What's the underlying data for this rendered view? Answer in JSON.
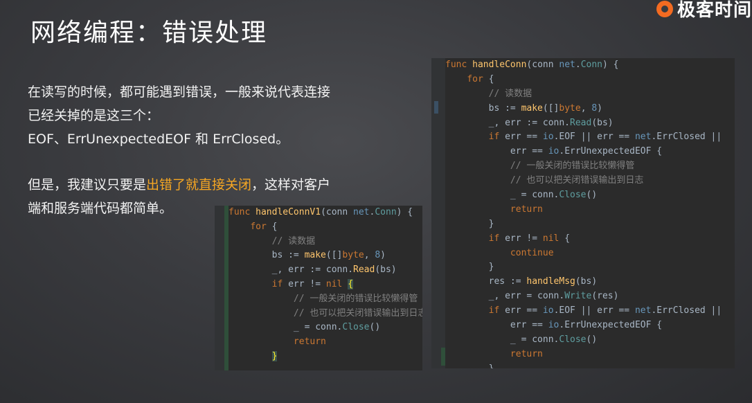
{
  "brand": {
    "logo_text": "极客时间"
  },
  "slide": {
    "title": "网络编程：错误处理",
    "p1_line1": "在读写的时候，都可能遇到错误，一般来说代表连接",
    "p1_line2": "已经关掉的是这三个：",
    "p1_line3": "EOF、ErrUnexpectedEOF 和 ErrClosed。",
    "p2_prefix": "但是，我建议只要是",
    "p2_highlight": "出错了就直接关闭",
    "p2_suffix": "，这样对客户",
    "p2_line2": "端和服务端代码都简单。"
  },
  "code_small": {
    "lines": [
      [
        [
          "kw",
          "func "
        ],
        [
          "call",
          "handleConnV1"
        ],
        [
          "plain",
          "(conn "
        ],
        [
          "pkg",
          "net"
        ],
        [
          "plain",
          "."
        ],
        [
          "method",
          "Conn"
        ],
        [
          "plain",
          ") {"
        ]
      ],
      [
        [
          "plain",
          "    "
        ],
        [
          "kw",
          "for"
        ],
        [
          "plain",
          " {"
        ]
      ],
      [
        [
          "plain",
          "        "
        ],
        [
          "cm",
          "// 读数据"
        ]
      ],
      [
        [
          "plain",
          "        bs := "
        ],
        [
          "call",
          "make"
        ],
        [
          "plain",
          "([]"
        ],
        [
          "kw",
          "byte"
        ],
        [
          "plain",
          ", "
        ],
        [
          "num",
          "8"
        ],
        [
          "plain",
          ")"
        ]
      ],
      [
        [
          "plain",
          "        _, err := conn."
        ],
        [
          "call",
          "Read"
        ],
        [
          "plain",
          "(bs)"
        ]
      ],
      [
        [
          "plain",
          "        "
        ],
        [
          "kw",
          "if"
        ],
        [
          "plain",
          " err != "
        ],
        [
          "kw",
          "nil"
        ],
        [
          "plain",
          " "
        ],
        [
          "bracehl",
          "{"
        ]
      ],
      [
        [
          "plain",
          "            "
        ],
        [
          "cm",
          "// 一般关闭的错误比较懒得管"
        ]
      ],
      [
        [
          "plain",
          "            "
        ],
        [
          "cm",
          "// 也可以把关闭错误输出到日志"
        ]
      ],
      [
        [
          "plain",
          "            _ = conn."
        ],
        [
          "method",
          "Close"
        ],
        [
          "plain",
          "()"
        ]
      ],
      [
        [
          "plain",
          "            "
        ],
        [
          "kw",
          "return"
        ]
      ],
      [
        [
          "plain",
          "        "
        ],
        [
          "bracehl",
          "}"
        ]
      ]
    ]
  },
  "code_big": {
    "lines": [
      [
        [
          "kw",
          "func "
        ],
        [
          "call",
          "handleConn"
        ],
        [
          "plain",
          "(conn "
        ],
        [
          "pkg",
          "net"
        ],
        [
          "plain",
          "."
        ],
        [
          "method",
          "Conn"
        ],
        [
          "plain",
          ") {"
        ]
      ],
      [
        [
          "plain",
          "    "
        ],
        [
          "kw",
          "for"
        ],
        [
          "plain",
          " {"
        ]
      ],
      [
        [
          "plain",
          "        "
        ],
        [
          "cm",
          "// 读数据"
        ]
      ],
      [
        [
          "plain",
          "        bs := "
        ],
        [
          "call",
          "make"
        ],
        [
          "plain",
          "([]"
        ],
        [
          "kw",
          "byte"
        ],
        [
          "plain",
          ", "
        ],
        [
          "num",
          "8"
        ],
        [
          "plain",
          ")"
        ]
      ],
      [
        [
          "plain",
          "        _, err := conn."
        ],
        [
          "method",
          "Read"
        ],
        [
          "plain",
          "(bs)"
        ]
      ],
      [
        [
          "plain",
          "        "
        ],
        [
          "kw",
          "if"
        ],
        [
          "plain",
          " err == "
        ],
        [
          "pkg",
          "io"
        ],
        [
          "plain",
          ".EOF || err == "
        ],
        [
          "pkg",
          "net"
        ],
        [
          "plain",
          ".ErrClosed ||"
        ]
      ],
      [
        [
          "plain",
          "            err == "
        ],
        [
          "pkg",
          "io"
        ],
        [
          "plain",
          ".ErrUnexpectedEOF {"
        ]
      ],
      [
        [
          "plain",
          "            "
        ],
        [
          "cm",
          "// 一般关闭的错误比较懒得管"
        ]
      ],
      [
        [
          "plain",
          "            "
        ],
        [
          "cm",
          "// 也可以把关闭错误输出到日志"
        ]
      ],
      [
        [
          "plain",
          "            _ = conn."
        ],
        [
          "method",
          "Close"
        ],
        [
          "plain",
          "()"
        ]
      ],
      [
        [
          "plain",
          "            "
        ],
        [
          "kw",
          "return"
        ]
      ],
      [
        [
          "plain",
          "        }"
        ]
      ],
      [
        [
          "plain",
          "        "
        ],
        [
          "kw",
          "if"
        ],
        [
          "plain",
          " err != "
        ],
        [
          "kw",
          "nil"
        ],
        [
          "plain",
          " {"
        ]
      ],
      [
        [
          "plain",
          "            "
        ],
        [
          "kw",
          "continue"
        ]
      ],
      [
        [
          "plain",
          "        }"
        ]
      ],
      [
        [
          "plain",
          "        res := "
        ],
        [
          "call",
          "handleMsg"
        ],
        [
          "plain",
          "(bs)"
        ]
      ],
      [
        [
          "plain",
          "        _, err = conn."
        ],
        [
          "method",
          "Write"
        ],
        [
          "plain",
          "(res)"
        ]
      ],
      [
        [
          "plain",
          "        "
        ],
        [
          "kw",
          "if"
        ],
        [
          "plain",
          " err == "
        ],
        [
          "pkg",
          "io"
        ],
        [
          "plain",
          ".EOF || err == "
        ],
        [
          "pkg",
          "net"
        ],
        [
          "plain",
          ".ErrClosed ||"
        ]
      ],
      [
        [
          "plain",
          "            err == "
        ],
        [
          "pkg",
          "io"
        ],
        [
          "plain",
          ".ErrUnexpectedEOF {"
        ]
      ],
      [
        [
          "plain",
          "            _ = conn."
        ],
        [
          "method",
          "Close"
        ],
        [
          "plain",
          "()"
        ]
      ],
      [
        [
          "plain",
          "            "
        ],
        [
          "kw",
          "return"
        ]
      ],
      [
        [
          "plain",
          "        }"
        ]
      ]
    ]
  },
  "colors": {
    "highlight": "#f5a623",
    "keyword": "#cc7832",
    "comment": "#808080",
    "function": "#ffc66d",
    "number": "#6897bb",
    "editor_bg": "#2b2b2b"
  }
}
